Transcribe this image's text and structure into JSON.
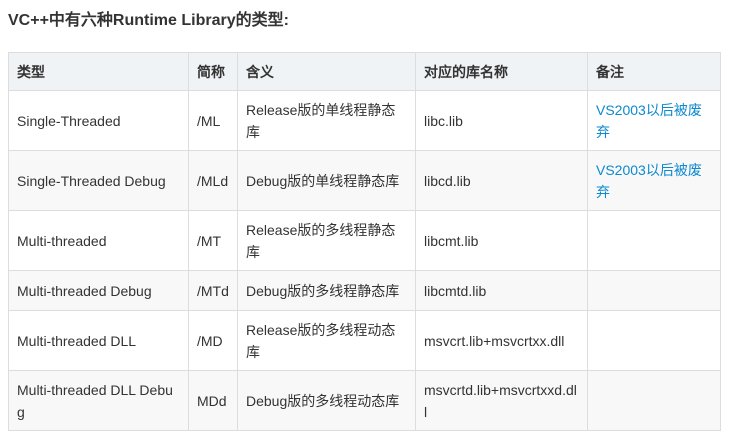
{
  "heading": "VC++中有六种Runtime Library的类型:",
  "table": {
    "headers": [
      "类型",
      "简称",
      "含义",
      "对应的库名称",
      "备注"
    ],
    "rows": [
      [
        "Single-Threaded",
        "/ML",
        "Release版的单线程静态库",
        "libc.lib",
        "VS2003以后被废弃"
      ],
      [
        "Single-Threaded Debug",
        "/MLd",
        "Debug版的单线程静态库",
        "libcd.lib",
        "VS2003以后被废弃"
      ],
      [
        "Multi-threaded",
        "/MT",
        "Release版的多线程静态库",
        "libcmt.lib",
        ""
      ],
      [
        "Multi-threaded Debug",
        "/MTd",
        "Debug版的多线程静态库",
        "libcmtd.lib",
        ""
      ],
      [
        "Multi-threaded DLL",
        "/MD",
        "Release版的多线程动态库",
        "msvcrt.lib+msvcrtxx.dll",
        ""
      ],
      [
        "Multi-threaded DLL Debug",
        "MDd",
        "Debug版的多线程动态库",
        "msvcrtd.lib+msvcrtxxd.dll",
        ""
      ]
    ]
  },
  "colors": {
    "header_bg": "#eff3f5",
    "stripe_bg": "#f8f8f8",
    "border": "#dddddd",
    "note_link": "#0c89cf",
    "text": "#333333"
  }
}
